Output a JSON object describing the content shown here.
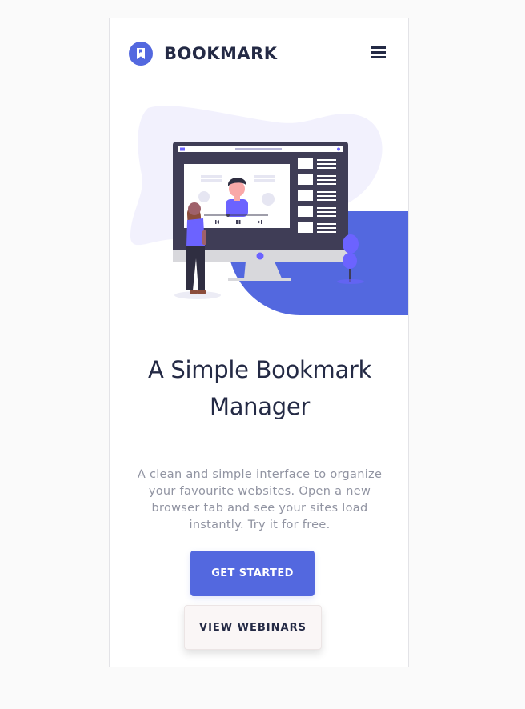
{
  "header": {
    "brand": "BOOKMARK",
    "logo_icon": "bookmark-icon",
    "menu_icon": "hamburger-menu-icon"
  },
  "hero": {
    "illustration": "person-watching-video-on-monitor-illustration",
    "title_line1": "A Simple Bookmark",
    "title_line2": "Manager",
    "description": "A clean and simple interface to organize your favourite websites. Open a new browser tab and see your sites load instantly. Try it for free."
  },
  "actions": {
    "primary_label": "GET STARTED",
    "secondary_label": "VIEW WEBINARS"
  },
  "colors": {
    "accent": "#5368df",
    "text_dark": "#242a45",
    "text_muted": "#9194a2",
    "blob": "#f1f1fd",
    "secondary_bg": "#faf6f6"
  }
}
